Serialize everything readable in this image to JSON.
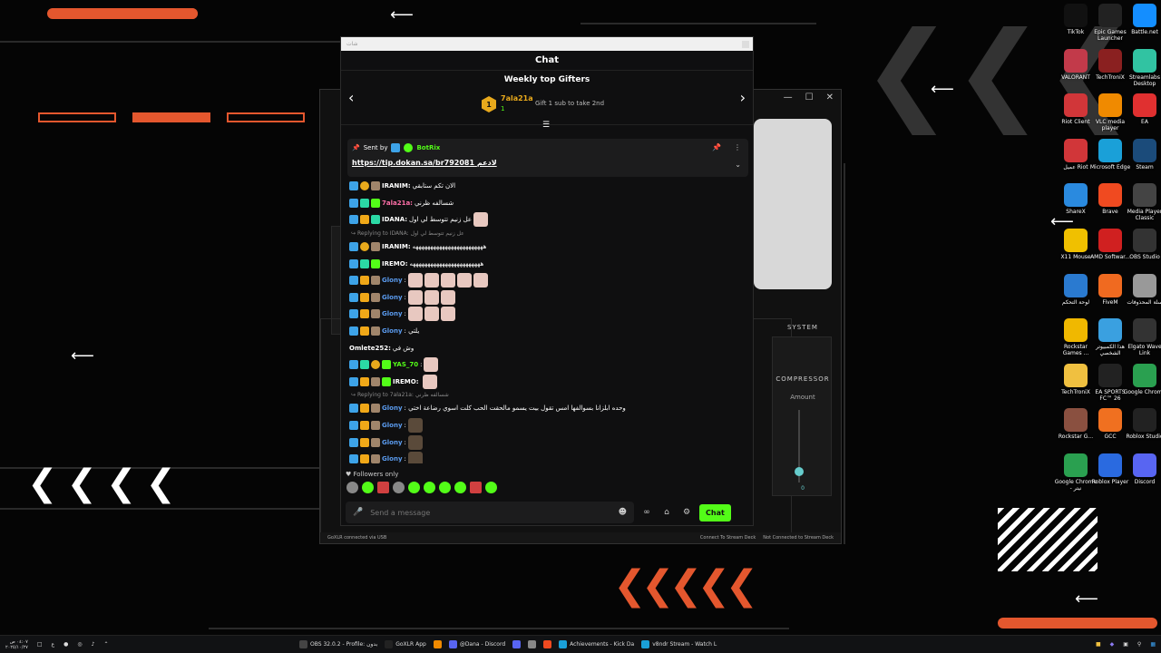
{
  "colors": {
    "accent_green": "#53fc18",
    "desktop_orange": "#e4572e",
    "gold": "#e8a91c"
  },
  "chat": {
    "window_title": "شات",
    "header": "Chat",
    "gifters": {
      "title": "Weekly top Gifters",
      "rank": "1",
      "top_name": "7ala21a",
      "top_count": "1",
      "next_hint": "Gift 1 sub to take 2nd"
    },
    "pinned": {
      "sent_by": "Sent by",
      "bot_name": "BotRix",
      "link": "https://tip.dokan.sa/br792081",
      "link_suffix": "لادعم"
    },
    "messages": [
      {
        "kind": "msg",
        "user": "IRANIM:",
        "color": "#ffffff",
        "text": "الان تكم ستابقي",
        "badges": [
          "blue",
          "gold",
          "brown"
        ]
      },
      {
        "kind": "msg",
        "user": "7ala21a:",
        "color": "#ff6fa8",
        "text": "شسالفه ظرني",
        "badges": [
          "blue",
          "teal",
          "green"
        ]
      },
      {
        "kind": "msg",
        "user": "IDANA:",
        "color": "#ffffff",
        "text": "عل زنيم تتوسط لي اول",
        "badges": [
          "blue",
          "crown",
          "teal"
        ],
        "emotes": 1
      },
      {
        "kind": "reply",
        "text": "Replying to IDANA: عل زنيم تتوسط لي اول"
      },
      {
        "kind": "msg",
        "user": "IRANIM:",
        "color": "#ffffff",
        "text": "ههههههههههههههههههههههههه",
        "badges": [
          "blue",
          "gold",
          "brown"
        ]
      },
      {
        "kind": "msg",
        "user": "IREMO:",
        "color": "#ffffff",
        "text": "ههههههههههههههههههههههههه",
        "badges": [
          "blue",
          "teal",
          "green"
        ]
      },
      {
        "kind": "msg",
        "user": "Glony",
        "color": "#5b9cf0",
        "text": ":",
        "badges": [
          "blue",
          "crown",
          "brown"
        ],
        "emotes": 5
      },
      {
        "kind": "msg",
        "user": "Glony",
        "color": "#5b9cf0",
        "text": ":",
        "badges": [
          "blue",
          "crown",
          "brown"
        ],
        "emotes": 3
      },
      {
        "kind": "msg",
        "user": "Glony",
        "color": "#5b9cf0",
        "text": ":",
        "badges": [
          "blue",
          "crown",
          "brown"
        ],
        "emotes": 3
      },
      {
        "kind": "msg",
        "user": "Glony",
        "color": "#5b9cf0",
        "text": ": يلتي",
        "badges": [
          "blue",
          "crown",
          "brown"
        ]
      },
      {
        "kind": "msg",
        "user": "Omlete252:",
        "color": "#ffffff",
        "text": "وش في",
        "badges": []
      },
      {
        "kind": "msg",
        "user": "YAS_70",
        "color": "#53fc18",
        "text": ":",
        "badges": [
          "blue",
          "teal",
          "gold",
          "green"
        ],
        "emotes": 1
      },
      {
        "kind": "msg",
        "user": "IREMO:",
        "color": "#ffffff",
        "text": "",
        "badges": [
          "blue",
          "crown",
          "brown",
          "green"
        ],
        "emotes": 1
      },
      {
        "kind": "reply",
        "text": "Replying to 7ala21a: شسالفه ظرني"
      },
      {
        "kind": "msg",
        "user": "Glony",
        "color": "#5b9cf0",
        "text": ": وحده ابلزانا بسوالفها امس تقول بيت يسمو مالحقت الحب كلت اسوي رضاعة اختي",
        "badges": [
          "blue",
          "crown",
          "brown"
        ]
      },
      {
        "kind": "msg",
        "user": "Glony",
        "color": "#5b9cf0",
        "text": ":",
        "badges": [
          "blue",
          "crown",
          "brown"
        ],
        "emotes": 1,
        "dark": true
      },
      {
        "kind": "msg",
        "user": "Glony",
        "color": "#5b9cf0",
        "text": ":",
        "badges": [
          "blue",
          "crown",
          "brown"
        ],
        "emotes": 1,
        "dark": true
      },
      {
        "kind": "msg",
        "user": "Glony",
        "color": "#5b9cf0",
        "text": ":",
        "badges": [
          "blue",
          "crown",
          "brown"
        ],
        "emotes": 1,
        "dark": true
      }
    ],
    "followers_only": "Followers only",
    "input_placeholder": "Send a message",
    "chat_button": "Chat"
  },
  "goxlr": {
    "system_label": "SYSTEM",
    "compressor": "COMPRESSOR",
    "amount": "Amount",
    "amount_value": "0",
    "status_left": "GoXLR connected via USB",
    "status_mid": "Connect To Stream Deck",
    "status_right": "Not Connected to Stream Deck"
  },
  "desktop_icons": [
    {
      "label": "TikTok",
      "icon": "tiktok-icon",
      "color": "#111"
    },
    {
      "label": "Epic Games Launcher",
      "icon": "epic-icon",
      "color": "#222"
    },
    {
      "label": "Battle.net",
      "icon": "battlenet-icon",
      "color": "#148eff"
    },
    {
      "label": "VALORANT",
      "icon": "valorant-icon",
      "color": "#c23a4a"
    },
    {
      "label": "TechTroniX",
      "icon": "techtronix-icon",
      "color": "#8a2020"
    },
    {
      "label": "Streamlabs Desktop",
      "icon": "streamlabs-icon",
      "color": "#31c3a2"
    },
    {
      "label": "Riot Client",
      "icon": "riot-icon",
      "color": "#d13639"
    },
    {
      "label": "VLC media player",
      "icon": "vlc-icon",
      "color": "#f08a00"
    },
    {
      "label": "EA",
      "icon": "ea-icon",
      "color": "#e03030"
    },
    {
      "label": "عميل Riot",
      "icon": "riot-icon",
      "color": "#d13639"
    },
    {
      "label": "Microsoft Edge",
      "icon": "edge-icon",
      "color": "#1aa0d8"
    },
    {
      "label": "Steam",
      "icon": "steam-icon",
      "color": "#1b4b7a"
    },
    {
      "label": "ShareX",
      "icon": "sharex-icon",
      "color": "#2a8adf"
    },
    {
      "label": "Brave",
      "icon": "brave-icon",
      "color": "#f04a20"
    },
    {
      "label": "Media Player Classic",
      "icon": "mpc-icon",
      "color": "#444"
    },
    {
      "label": "X11 Mouse",
      "icon": "x11-icon",
      "color": "#f0c000"
    },
    {
      "label": "AMD Softwar...",
      "icon": "amd-icon",
      "color": "#d02020"
    },
    {
      "label": "OBS Studio",
      "icon": "obs-icon",
      "color": "#333"
    },
    {
      "label": "لوحة التحكم",
      "icon": "control-panel-icon",
      "color": "#2a7ad0"
    },
    {
      "label": "FiveM",
      "icon": "fivem-icon",
      "color": "#f06a20"
    },
    {
      "label": "سلة المحذوفات",
      "icon": "recycle-bin-icon",
      "color": "#999"
    },
    {
      "label": "Rockstar Games ...",
      "icon": "rockstar-icon",
      "color": "#f0b800"
    },
    {
      "label": "هذا الكمبيوتر الشخصي",
      "icon": "this-pc-icon",
      "color": "#3aa0e0"
    },
    {
      "label": "Elgato Wave Link",
      "icon": "wavelink-icon",
      "color": "#333"
    },
    {
      "label": "TechTroniX",
      "icon": "folder-icon",
      "color": "#f0c040"
    },
    {
      "label": "EA SPORTS FC™ 26",
      "icon": "easports-icon",
      "color": "#222"
    },
    {
      "label": "Google Chrome",
      "icon": "chrome-icon",
      "color": "#2aa050"
    },
    {
      "label": "Rockstar G...",
      "icon": "rockstar-icon",
      "color": "#8a5040"
    },
    {
      "label": "GCC",
      "icon": "gcc-icon",
      "color": "#f07020"
    },
    {
      "label": "Roblox Studio",
      "icon": "roblox-studio-icon",
      "color": "#222"
    },
    {
      "label": "Google Chrome - نيتر",
      "icon": "chrome-icon",
      "color": "#2aa050"
    },
    {
      "label": "Roblox Player",
      "icon": "roblox-icon",
      "color": "#2a6ae0"
    },
    {
      "label": "Discord",
      "icon": "discord-icon",
      "color": "#5865f2"
    }
  ],
  "taskbar": {
    "time": "٠٤:٠٧ ص",
    "date": "٢٠٢٥/١٠/٢٧",
    "lang": "ع",
    "apps": [
      {
        "label": "OBS 32.0.2 - Profile: بدون",
        "color": "#444"
      },
      {
        "label": "GoXLR App",
        "color": "#222"
      },
      {
        "label": "",
        "color": "#f08a00"
      },
      {
        "label": "@Dana - Discord",
        "color": "#5865f2"
      },
      {
        "label": "",
        "color": "#5865f2"
      },
      {
        "label": "",
        "color": "#888"
      },
      {
        "label": "",
        "color": "#f04a20"
      },
      {
        "label": "Achievements - Kick Da",
        "color": "#1aa0d8"
      },
      {
        "label": "v8ndr Stream - Watch L",
        "color": "#1aa0d8"
      }
    ]
  }
}
